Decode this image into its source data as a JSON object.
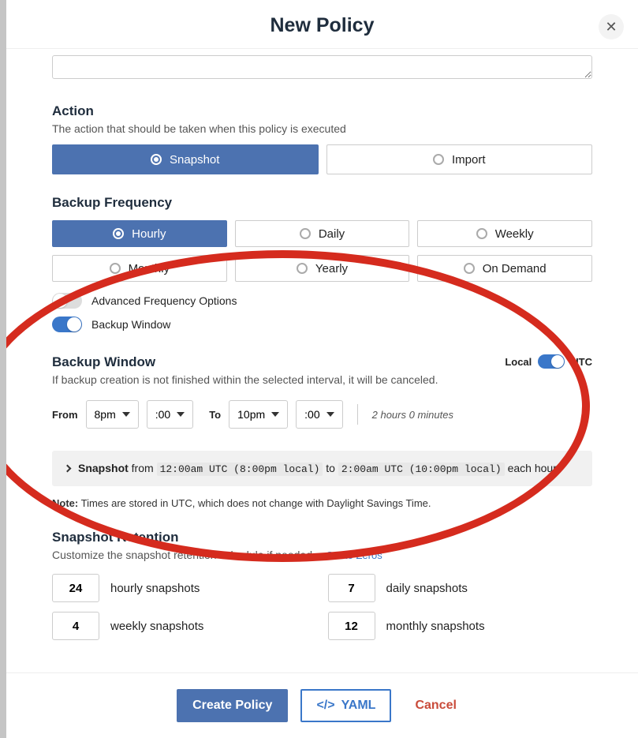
{
  "header": {
    "title": "New Policy"
  },
  "action": {
    "title": "Action",
    "desc": "The action that should be taken when this policy is executed",
    "options": {
      "snapshot": "Snapshot",
      "import": "Import"
    }
  },
  "frequency": {
    "title": "Backup Frequency",
    "options": {
      "hourly": "Hourly",
      "daily": "Daily",
      "weekly": "Weekly",
      "monthly": "Monthly",
      "yearly": "Yearly",
      "ondemand": "On Demand"
    }
  },
  "toggles": {
    "advanced": "Advanced Frequency Options",
    "backup_window": "Backup Window"
  },
  "backup_window": {
    "title": "Backup Window",
    "desc": "If backup creation is not finished within the selected interval, it will be canceled.",
    "tz_local": "Local",
    "tz_utc": "UTC",
    "from_label": "From",
    "to_label": "To",
    "from_hour": "8pm",
    "from_min": ":00",
    "to_hour": "10pm",
    "to_min": ":00",
    "duration": "2 hours 0 minutes"
  },
  "summary": {
    "snapshot": "Snapshot",
    "from_word": "from",
    "from_time": "12:00am UTC (8:00pm local)",
    "to_word": "to",
    "to_time": "2:00am UTC (10:00pm local)",
    "suffix": "each hour"
  },
  "note": {
    "label": "Note:",
    "text": "Times are stored in UTC, which does not change with Daylight Savings Time."
  },
  "retention": {
    "title": "Snapshot Retention",
    "desc": "Customize the snapshot retention schedule if needed.",
    "link": "Set to Zeros",
    "items": {
      "hourly_val": "24",
      "hourly_label": "hourly snapshots",
      "daily_val": "7",
      "daily_label": "daily snapshots",
      "weekly_val": "4",
      "weekly_label": "weekly snapshots",
      "monthly_val": "12",
      "monthly_label": "monthly snapshots"
    }
  },
  "footer": {
    "create": "Create Policy",
    "yaml": "YAML",
    "cancel": "Cancel"
  }
}
